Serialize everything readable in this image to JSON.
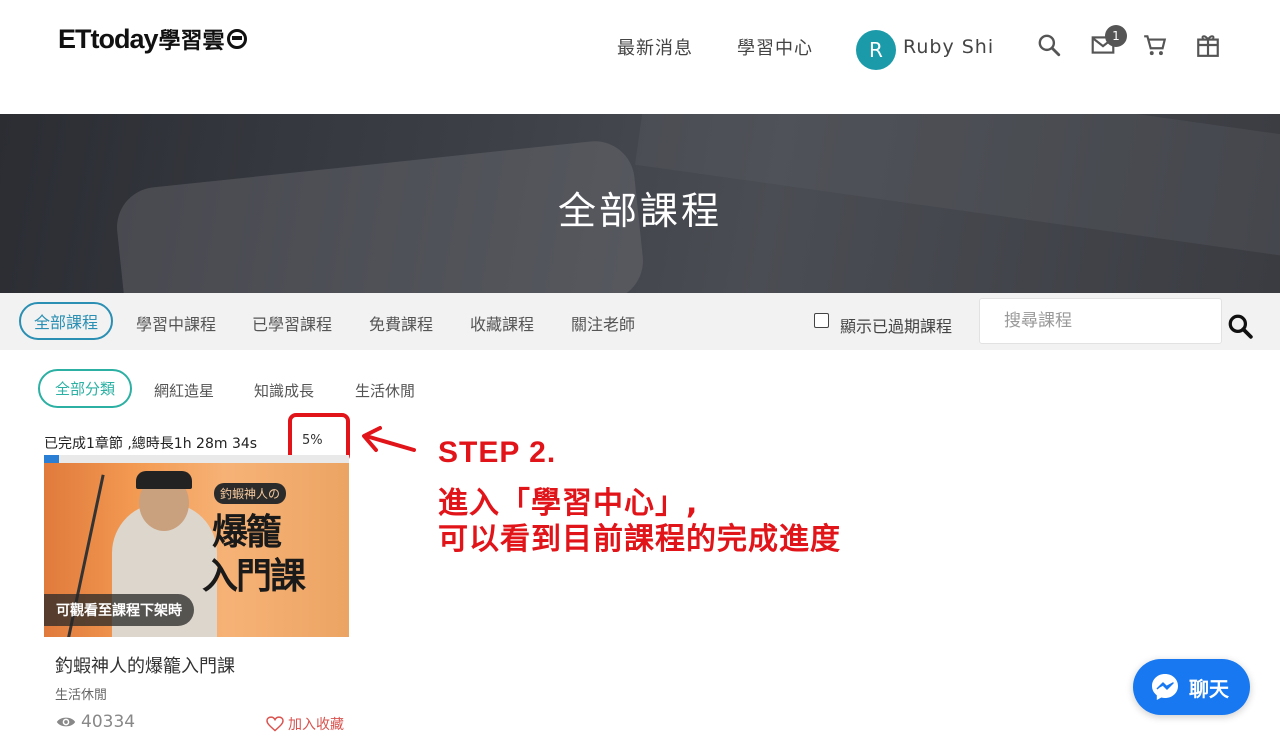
{
  "header": {
    "logo_text": "ETtoday",
    "logo_cn": "學習雲",
    "nav": [
      "最新消息",
      "學習中心"
    ],
    "avatar_letter": "R",
    "username": "Ruby Shi",
    "mail_badge": "1",
    "icons": [
      "search-icon",
      "mail-icon",
      "cart-icon",
      "gift-icon"
    ],
    "accent": "#1b9aa9"
  },
  "banner": {
    "title": "全部課程"
  },
  "tabs": {
    "active": "全部課程",
    "items": [
      "學習中課程",
      "已學習課程",
      "免費課程",
      "收藏課程",
      "關注老師"
    ],
    "show_expired_label": "顯示已過期課程",
    "search_placeholder": "搜尋課程"
  },
  "categories": {
    "active": "全部分類",
    "items": [
      "網紅造星",
      "知識成長",
      "生活休閒"
    ]
  },
  "course": {
    "progress_text": "已完成1章節 ,總時長1h 28m 34s",
    "percent_label": "5%",
    "progress_fraction": 0.05,
    "thumb_label": "可觀看至課程下架時",
    "thumb_tag": "釣蝦神人の",
    "thumb_title_line1": "爆籠",
    "thumb_title_line2": "入門課",
    "title": "釣蝦神人的爆籠入門課",
    "category": "生活休閒",
    "views": "40334",
    "favorite_label": "加入收藏"
  },
  "annotation": {
    "step": "STEP 2.",
    "line1": "進入「學習中心」,",
    "line2": "可以看到目前課程的完成進度",
    "color": "#e1141a"
  },
  "chat": {
    "label": "聊天",
    "color": "#1778f2"
  }
}
